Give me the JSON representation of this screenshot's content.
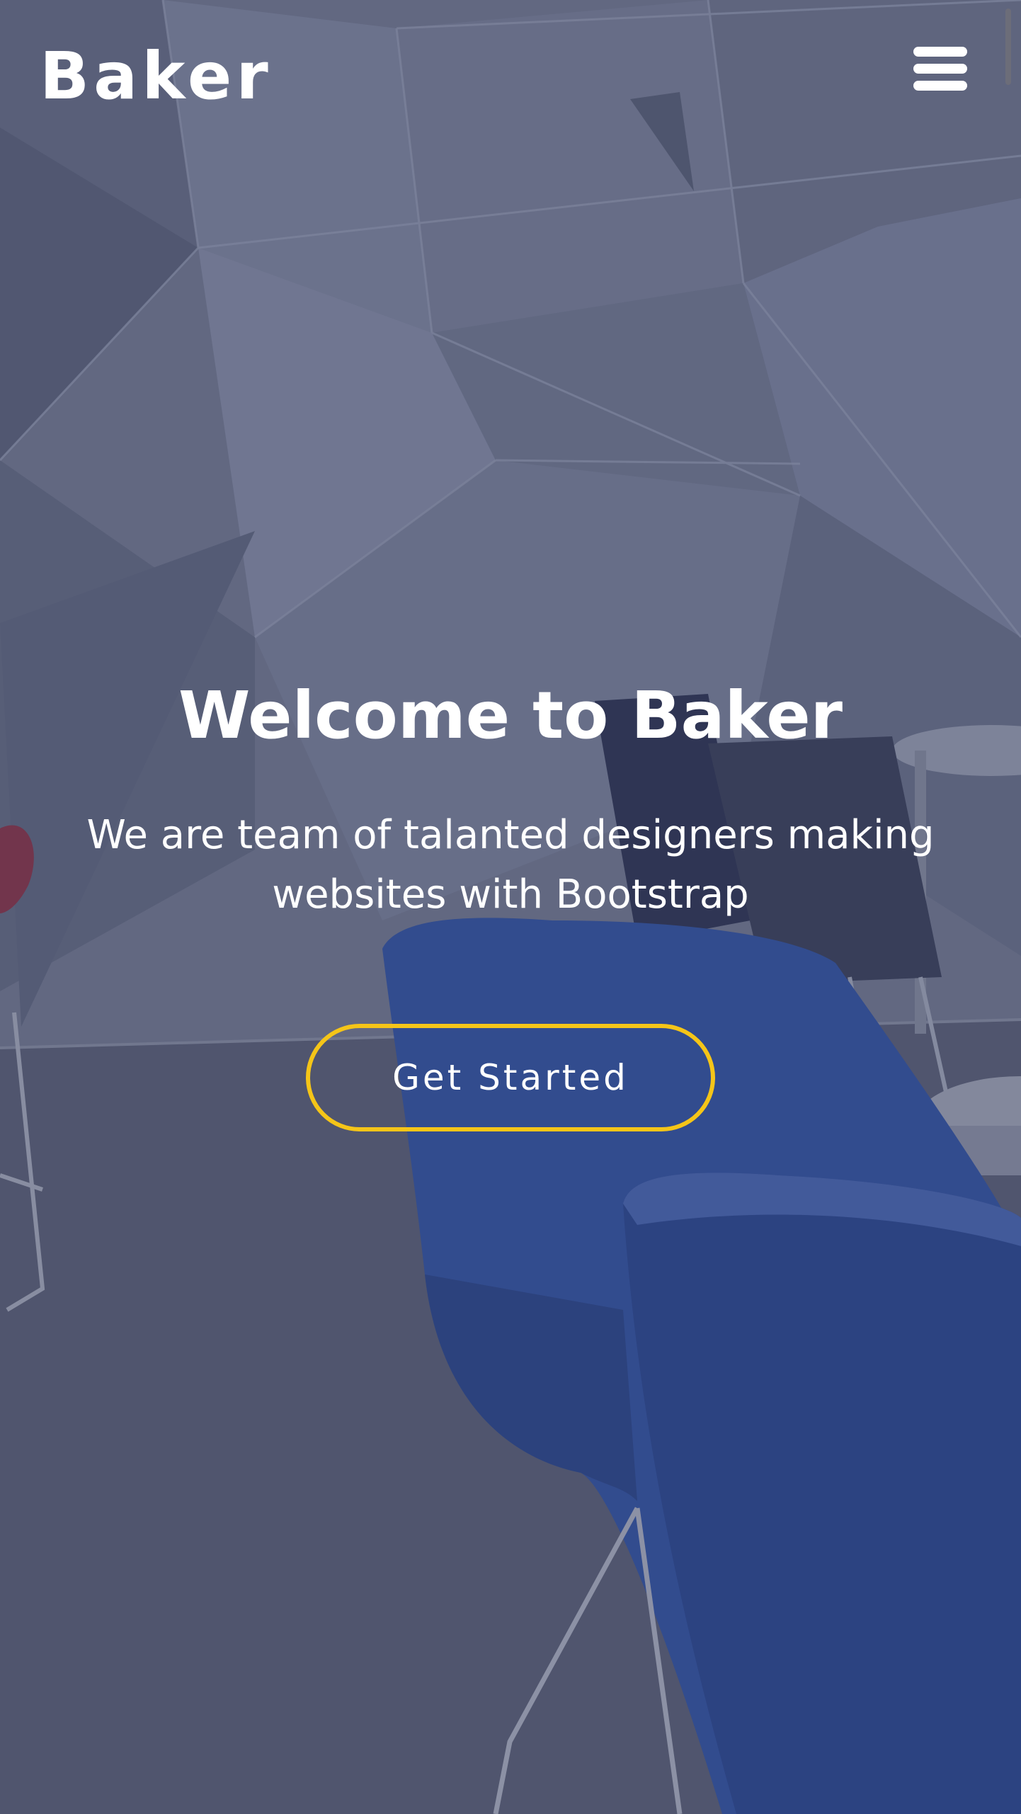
{
  "header": {
    "logo_text": "Baker",
    "menu_icon": "hamburger-menu-icon"
  },
  "hero": {
    "title": "Welcome to Baker",
    "subtitle": "We are team of talanted designers making websites with Bootstrap",
    "cta_label": "Get Started"
  },
  "colors": {
    "overlay": "#323c5f",
    "cta_border": "#f5c518",
    "text": "#ffffff",
    "chair_blue": "#2f4c94"
  }
}
